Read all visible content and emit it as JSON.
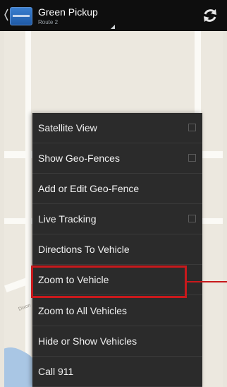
{
  "header": {
    "title": "Green Pickup",
    "subtitle": "Route 2",
    "icons": {
      "back": "chevron-left-icon",
      "app": "app-logo-icon",
      "refresh": "refresh-icon"
    }
  },
  "map": {
    "road_label": "Dixon"
  },
  "menu": {
    "items": [
      {
        "label": "Satellite View",
        "checkbox": true
      },
      {
        "label": "Show Geo-Fences",
        "checkbox": true
      },
      {
        "label": "Add or Edit Geo-Fence",
        "checkbox": false
      },
      {
        "label": "Live Tracking",
        "checkbox": true
      },
      {
        "label": "Directions To Vehicle",
        "checkbox": false
      },
      {
        "label": "Zoom to Vehicle",
        "checkbox": false,
        "highlighted": true
      },
      {
        "label": "Zoom to All Vehicles",
        "checkbox": false
      },
      {
        "label": "Hide or Show Vehicles",
        "checkbox": false
      },
      {
        "label": "Call 911",
        "checkbox": false
      }
    ]
  },
  "colors": {
    "highlight": "#c8191c",
    "menu_bg": "#2b2b2b",
    "actionbar_bg": "#0e0e0e"
  }
}
